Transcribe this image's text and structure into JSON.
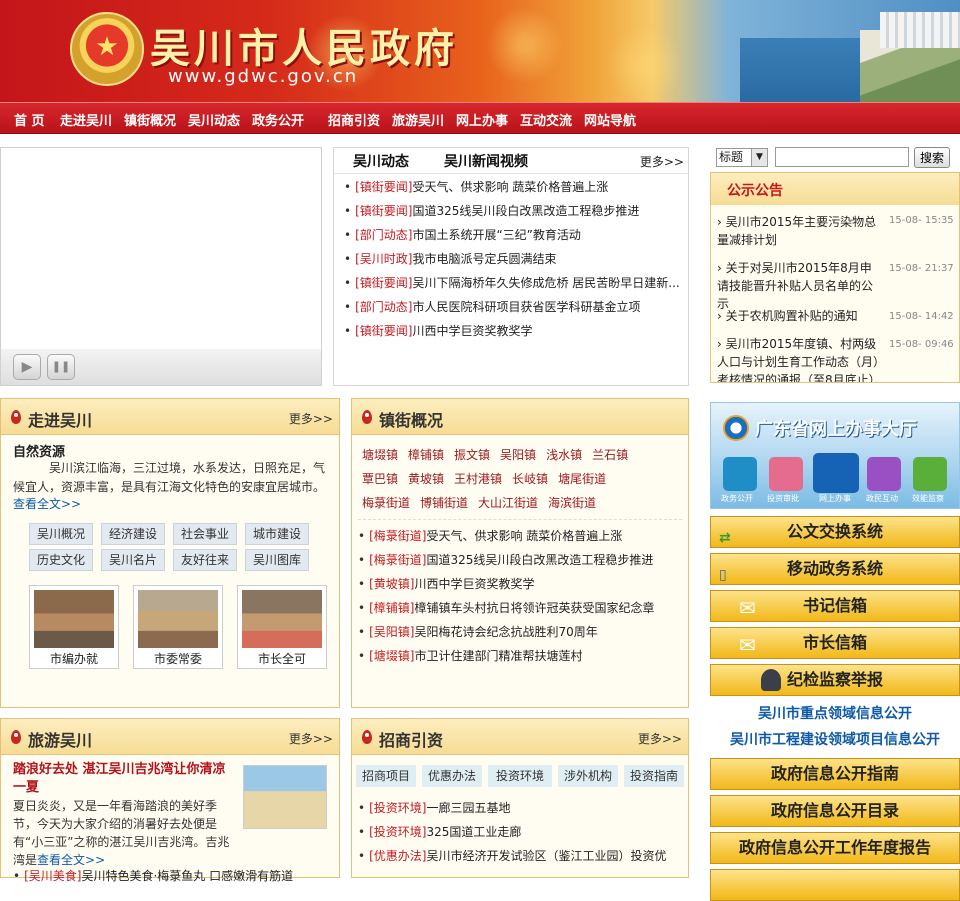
{
  "banner": {
    "title": "吴川市人民政府",
    "url": "www.gdwc.gov.cn",
    "emblem": "★"
  },
  "nav": [
    {
      "label": "首 页"
    },
    {
      "label": "走进吴川"
    },
    {
      "label": "镇街概况"
    },
    {
      "label": "吴川动态"
    },
    {
      "label": "政务公开"
    },
    {
      "label": "招商引资"
    },
    {
      "label": "旅游吴川"
    },
    {
      "label": "网上办事"
    },
    {
      "label": "互动交流"
    },
    {
      "label": "网站导航"
    }
  ],
  "video": {
    "play_icon": "▶",
    "pause_icon": "❚❚"
  },
  "news": {
    "tabs": [
      "吴川动态",
      "吴川新闻视频"
    ],
    "more": "更多>>",
    "items": [
      {
        "cat": "[镇街要闻]",
        "title": "受天气、供求影响 蔬菜价格普遍上涨"
      },
      {
        "cat": "[镇街要闻]",
        "title": "国道325线吴川段白改黑改造工程稳步推进"
      },
      {
        "cat": "[部门动态]",
        "title": "市国土系统开展“三纪”教育活动"
      },
      {
        "cat": "[吴川时政]",
        "title": "我市电脑派号定兵圆满结束"
      },
      {
        "cat": "[镇街要闻]",
        "title": "吴川下隔海桥年久失修成危桥 居民苦盼早日建新..."
      },
      {
        "cat": "[部门动态]",
        "title": "市人民医院科研项目获省医学科研基金立项"
      },
      {
        "cat": "[镇街要闻]",
        "title": "川西中学巨资奖教奖学"
      }
    ]
  },
  "search": {
    "select": "标题",
    "button": "搜索",
    "placeholder": ""
  },
  "notice": {
    "title": "公示公告",
    "items": [
      {
        "title": "吴川市2015年主要污染物总量减排计划",
        "date": "15-08- 15:35"
      },
      {
        "title": "关于对吴川市2015年8月申请技能晋升补贴人员名单的公示",
        "date": "15-08- 21:37"
      },
      {
        "title": "关于农机购置补贴的通知",
        "date": "15-08- 14:42"
      },
      {
        "title": "吴川市2015年度镇、村两级人口与计划生育工作动态（月）考核情况的通报（至8月底止）",
        "date": "15-08- 09:46"
      }
    ]
  },
  "zoujin": {
    "title": "走进吴川",
    "more": "更多>>",
    "subtitle": "自然资源",
    "text": "吴川滨江临海，三江过境，水系发达，日照充足，气候宜人，资源丰富，是具有江海文化特色的安康宜居城市。",
    "read_all": "查看全文>>",
    "tags": [
      "吴川概况",
      "经济建设",
      "社会事业",
      "城市建设",
      "历史文化",
      "吴川名片",
      "友好往来",
      "吴川图库"
    ],
    "photos": [
      {
        "caption": "市编办就"
      },
      {
        "caption": "市委常委"
      },
      {
        "caption": "市长全可"
      }
    ]
  },
  "zhenjie": {
    "title": "镇街概况",
    "more": "",
    "towns": [
      "塘㙍镇",
      "樟铺镇",
      "振文镇",
      "吴阳镇",
      "浅水镇",
      "兰石镇",
      "覃巴镇",
      "黄坡镇",
      "王村港镇",
      "长岐镇",
      "塘尾街道",
      "梅菉街道",
      "博铺街道",
      "大山江街道",
      "海滨街道"
    ],
    "items": [
      {
        "cat": "[梅菉街道]",
        "title": "受天气、供求影响 蔬菜价格普遍上涨"
      },
      {
        "cat": "[梅菉街道]",
        "title": "国道325线吴川段白改黑改造工程稳步推进"
      },
      {
        "cat": "[黄坡镇]",
        "title": "川西中学巨资奖教奖学"
      },
      {
        "cat": "[樟铺镇]",
        "title": "樟铺镇车头村抗日将领许冠英获受国家纪念章"
      },
      {
        "cat": "[吴阳镇]",
        "title": "吴阳梅花诗会纪念抗战胜利70周年"
      },
      {
        "cat": "[塘㙍镇]",
        "title": "市卫计住建部门精准帮扶塘莲村"
      }
    ]
  },
  "lvyou": {
    "title": "旅游吴川",
    "more": "更多>>",
    "headline": "踏浪好去处 湛江吴川吉兆湾让你清凉一夏",
    "text": "夏日炎炎，又是一年看海踏浪的美好季节，今天为大家介绍的消暑好去处便是有“小三亚”之称的湛江吴川吉兆湾。吉兆湾是",
    "read_all": "查看全文>>",
    "items": [
      {
        "cat": "[吴川美食]",
        "title": "吴川特色美食·梅菉鱼丸 口感嫩滑有筋道"
      }
    ]
  },
  "zhaoshang": {
    "title": "招商引资",
    "more": "更多>>",
    "tags": [
      "招商项目",
      "优惠办法",
      "投资环境",
      "涉外机构",
      "投资指南"
    ],
    "items": [
      {
        "cat": "[投资环境]",
        "title": "一廊三园五基地"
      },
      {
        "cat": "[投资环境]",
        "title": "325国道工业走廊"
      },
      {
        "cat": "[优惠办法]",
        "title": "吴川市经济开发试验区（鉴江工业园）投资优"
      }
    ]
  },
  "service_hall": {
    "title": "广东省网上办事大厅",
    "icons": [
      {
        "label": "政务公开"
      },
      {
        "label": "投资审批"
      },
      {
        "label": "网上办事"
      },
      {
        "label": "政民互动"
      },
      {
        "label": "效能监察"
      }
    ]
  },
  "side_buttons": [
    {
      "label": "公文交换系统",
      "icon": "exchange-icon"
    },
    {
      "label": "移动政务系统",
      "icon": "mobile-icon"
    },
    {
      "label": "书记信箱",
      "icon": "envelope-icon"
    },
    {
      "label": "市长信箱",
      "icon": "envelope-icon"
    },
    {
      "label": "纪检监察举报",
      "icon": "officer-icon"
    }
  ],
  "side_links": [
    "吴川市重点领域信息公开",
    "吴川市工程建设领域项目信息公开"
  ],
  "side_buttons2": [
    "政府信息公开指南",
    "政府信息公开目录",
    "政府信息公开工作年度报告"
  ]
}
